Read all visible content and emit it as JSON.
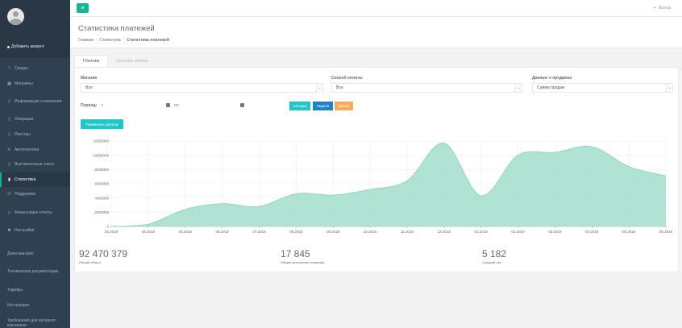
{
  "sidebar": {
    "add_account": "Добавить аккаунт",
    "items": [
      {
        "label": "Сводка",
        "icon": "chart-line-icon"
      },
      {
        "label": "Магазины",
        "icon": "shop-icon"
      },
      {
        "label": "Информация о компании",
        "icon": "file-icon"
      },
      {
        "label": "Операции",
        "icon": "file-icon"
      },
      {
        "label": "Реестры",
        "icon": "file-icon"
      },
      {
        "label": "Автоплатежи",
        "icon": "sync-icon"
      },
      {
        "label": "Выставленные счета",
        "icon": "file-icon"
      },
      {
        "label": "Статистика",
        "icon": "bar-chart-icon"
      },
      {
        "label": "Поддержка",
        "icon": "phone-icon"
      },
      {
        "label": "Финансовые отчеты",
        "icon": "file-icon"
      },
      {
        "label": "Настройки",
        "icon": "gear-icon"
      }
    ],
    "bottom": [
      "Демо-магазин",
      "Техническая документация",
      "Тарифы",
      "Инструкция",
      "Требования для интернет-магазинов"
    ]
  },
  "topbar": {
    "menu_icon": "≡",
    "logout": "Выход"
  },
  "heading": {
    "title": "Статистика платежей",
    "crumbs": [
      "Главная",
      "Статистика",
      "Статистика платежей"
    ]
  },
  "tabs": [
    "Платежи",
    "Способы оплаты"
  ],
  "filters": {
    "shop_label": "Магазин",
    "shop_value": "Все",
    "method_label": "Способ оплаты",
    "method_value": "Все",
    "sales_label": "Данные о продажах",
    "sales_value": "Сумма продаж",
    "period_label": "Период:",
    "from_prefix": "с",
    "to_prefix": "по",
    "btn_today": "Сегодня",
    "btn_week": "Неделя",
    "btn_month": "Месяц",
    "apply": "Применить фильтр"
  },
  "colors": {
    "today": "#23c6c8",
    "week": "#1c84c6",
    "month": "#f8ac59",
    "fill": "#a8e0d0",
    "stroke": "#8fd6c1"
  },
  "chart_data": {
    "type": "area",
    "x": [
      "03.2018",
      "04.2018",
      "05.2018",
      "06.2018",
      "07.2018",
      "08.2018",
      "09.2018",
      "10.2018",
      "11.2018",
      "12.2018",
      "01.2019",
      "02.2019",
      "03.2019",
      "04.2019",
      "05.2019",
      "06.2019"
    ],
    "values": [
      0,
      300000,
      2400000,
      3200000,
      2800000,
      4600000,
      4400000,
      5200000,
      6400000,
      11700000,
      4300000,
      10000000,
      10400000,
      11200000,
      8400000,
      7100000
    ],
    "y_ticks": [
      "0",
      "2000000",
      "4000000",
      "6000000",
      "8000000",
      "10000000",
      "12000000"
    ],
    "ylim": [
      0,
      12000000
    ],
    "grid": true
  },
  "stats": [
    {
      "value": "92 470 379",
      "label": "Общий оборот"
    },
    {
      "value": "17 845",
      "label": "Общее количество операций"
    },
    {
      "value": "5 182",
      "label": "Средний чек"
    }
  ]
}
